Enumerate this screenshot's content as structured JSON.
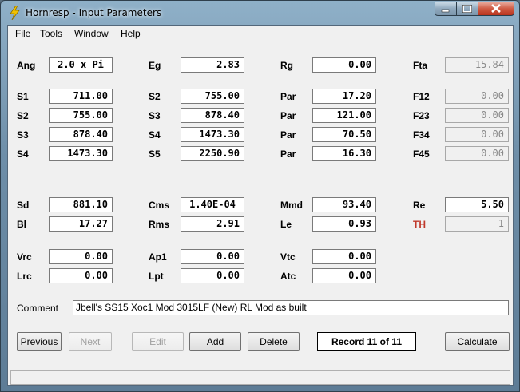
{
  "window": {
    "title": "Hornresp - Input Parameters"
  },
  "menu": [
    "File",
    "Tools",
    "Window",
    "Help"
  ],
  "row0": [
    {
      "label": "Ang",
      "value": "2.0 x Pi"
    },
    {
      "label": "Eg",
      "value": "2.83"
    },
    {
      "label": "Rg",
      "value": "0.00"
    },
    {
      "label": "Fta",
      "value": "15.84"
    }
  ],
  "horn": [
    [
      {
        "label": "S1",
        "value": "711.00"
      },
      {
        "label": "S2",
        "value": "755.00"
      },
      {
        "label": "Par",
        "value": "17.20"
      },
      {
        "label": "F12",
        "value": "0.00"
      }
    ],
    [
      {
        "label": "S2",
        "value": "755.00"
      },
      {
        "label": "S3",
        "value": "878.40"
      },
      {
        "label": "Par",
        "value": "121.00"
      },
      {
        "label": "F23",
        "value": "0.00"
      }
    ],
    [
      {
        "label": "S3",
        "value": "878.40"
      },
      {
        "label": "S4",
        "value": "1473.30"
      },
      {
        "label": "Par",
        "value": "70.50"
      },
      {
        "label": "F34",
        "value": "0.00"
      }
    ],
    [
      {
        "label": "S4",
        "value": "1473.30"
      },
      {
        "label": "S5",
        "value": "2250.90"
      },
      {
        "label": "Par",
        "value": "16.30"
      },
      {
        "label": "F45",
        "value": "0.00"
      }
    ]
  ],
  "driver": [
    [
      {
        "label": "Sd",
        "value": "881.10"
      },
      {
        "label": "Cms",
        "value": "1.40E-04"
      },
      {
        "label": "Mmd",
        "value": "93.40"
      },
      {
        "label": "Re",
        "value": "5.50"
      }
    ],
    [
      {
        "label": "Bl",
        "value": "17.27"
      },
      {
        "label": "Rms",
        "value": "2.91"
      },
      {
        "label": "Le",
        "value": "0.93"
      },
      {
        "label": "TH",
        "value": "1"
      }
    ]
  ],
  "chamber": [
    [
      {
        "label": "Vrc",
        "value": "0.00"
      },
      {
        "label": "Ap1",
        "value": "0.00"
      },
      {
        "label": "Vtc",
        "value": "0.00"
      }
    ],
    [
      {
        "label": "Lrc",
        "value": "0.00"
      },
      {
        "label": "Lpt",
        "value": "0.00"
      },
      {
        "label": "Atc",
        "value": "0.00"
      }
    ]
  ],
  "comment": {
    "label": "Comment",
    "value": "Jbell's SS15 Xoc1 Mod 3015LF (New) RL Mod as built"
  },
  "buttons": {
    "previous": {
      "pre": "",
      "accel": "P",
      "post": "revious"
    },
    "next": {
      "pre": "",
      "accel": "N",
      "post": "ext"
    },
    "edit": {
      "pre": "",
      "accel": "E",
      "post": "dit"
    },
    "add": {
      "pre": "",
      "accel": "A",
      "post": "dd"
    },
    "delete": {
      "pre": "",
      "accel": "D",
      "post": "elete"
    },
    "calculate": {
      "pre": "",
      "accel": "C",
      "post": "alculate"
    }
  },
  "record": "Record 11 of 11",
  "colors": {
    "label_red": "#c0392b",
    "titlebar": "#6e8ea8",
    "close": "#cf5a43"
  }
}
